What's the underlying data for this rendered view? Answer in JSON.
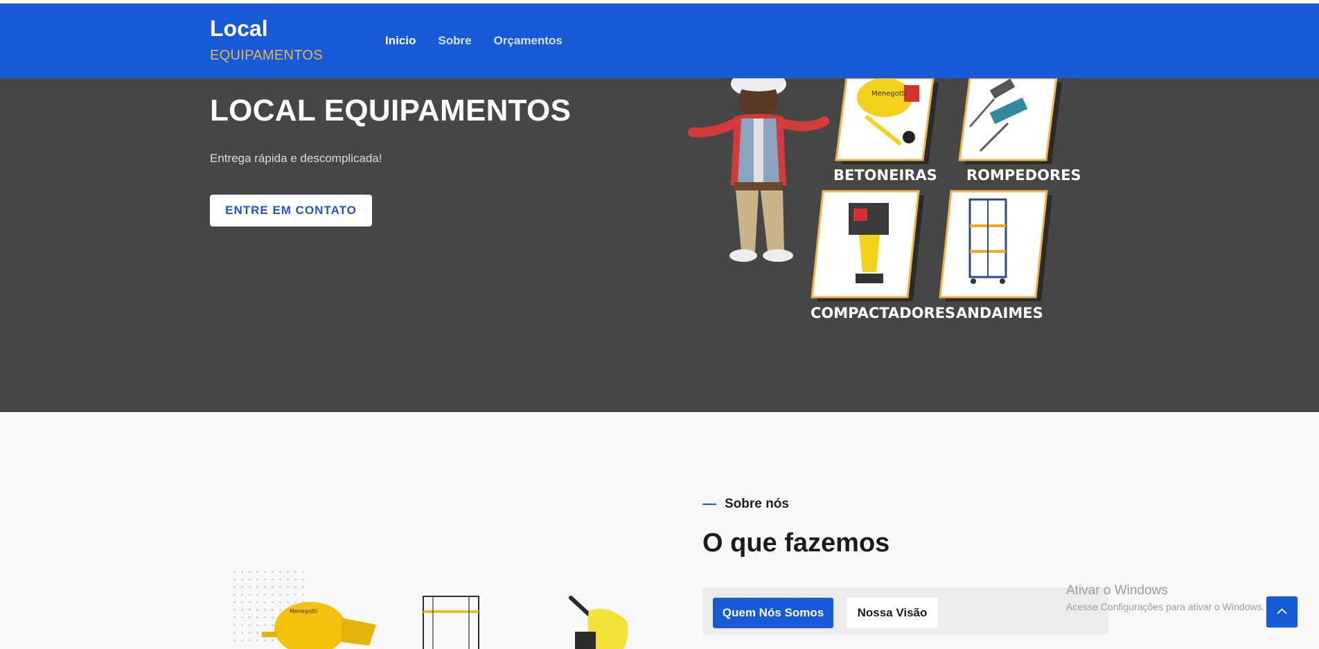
{
  "header": {
    "brand_title": "Local",
    "brand_subtitle": "EQUIPAMENTOS",
    "nav": [
      "Inicio",
      "Sobre",
      "Orçamentos"
    ]
  },
  "hero": {
    "title": "LOCAL EQUIPAMENTOS",
    "subtitle": "Entrega rápida e descomplicada!",
    "cta": "ENTRE EM CONTATO",
    "cards": [
      "BETONEIRAS",
      "ROMPEDORES",
      "COMPACTADORES",
      "ANDAIMES"
    ],
    "mixer_brand": "Menegotti"
  },
  "about": {
    "kicker": "Sobre nós",
    "title": "O que fazemos",
    "tabs": [
      "Quem Nós Somos",
      "Nossa Visão"
    ]
  },
  "watermark": {
    "line1": "Ativar o Windows",
    "line2": "Acesse Configurações para ativar o Windows."
  },
  "colors": {
    "brand_blue": "#175ad8",
    "brand_orange": "#f0b349",
    "hero_bg": "#464646"
  },
  "icons": {
    "back_to_top": "chevron-up-icon"
  }
}
